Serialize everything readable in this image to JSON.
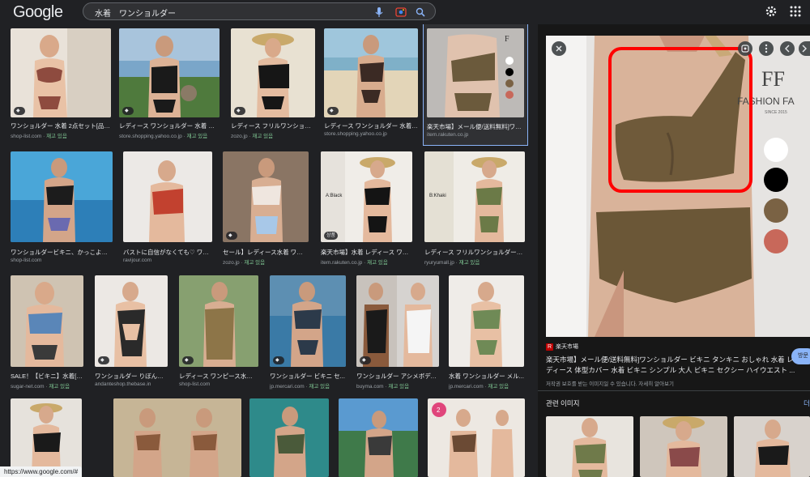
{
  "header": {
    "logo": "Google",
    "query": "水着　ワンショルダー"
  },
  "results": [
    {
      "title": "ワンショルダー 水着 2点セット[品番...",
      "source": "shop-list.com",
      "stock": "재고 있음",
      "badge": ""
    },
    {
      "title": "レディース ワンショルダー 水着 胸囲 ...",
      "source": "store.shopping.yahoo.co.jp",
      "stock": "재고 있음",
      "badge": ""
    },
    {
      "title": "レディース フリルワンショル...",
      "source": "zozo.jp",
      "stock": "재고 있음",
      "badge": ""
    },
    {
      "title": "レディース ワンショルダー 水着 ...",
      "source": "store.shopping.yahoo.co.jp",
      "stock": "",
      "badge": ""
    },
    {
      "title": "楽天市場】メール便/送料無料]ワン...",
      "source": "item.rakuten.co.jp",
      "stock": "",
      "badge": ""
    },
    {
      "title": "ワンショルダービキニ、かっこよく決...",
      "source": "shop-list.com",
      "stock": "",
      "badge": ""
    },
    {
      "title": "バストに自信がなくても♡ ワン...",
      "source": "ravijour.com",
      "stock": "",
      "badge": ""
    },
    {
      "title": "セール】レディース水着 ワンシ...",
      "source": "zozo.jp",
      "stock": "재고 있음",
      "badge": ""
    },
    {
      "title": "楽天市場】水着 レディース ワン...",
      "source": "item.rakuten.co.jp",
      "stock": "재고 있음",
      "badge": "상품"
    },
    {
      "title": "レディース フリルワンショルダービ...",
      "source": "ryuryumall.jp",
      "stock": "재고 있음",
      "badge": ""
    },
    {
      "title": "SALE！【ビキニ】水着[ワ...",
      "source": "sugar-net.com",
      "stock": "재고 있음",
      "badge": ""
    },
    {
      "title": "ワンショルダー りぼんバイ...",
      "source": "andanteshop.thebase.in",
      "stock": "",
      "badge": ""
    },
    {
      "title": "レディース ワンピース水着 ...",
      "source": "shop-list.com",
      "stock": "",
      "badge": ""
    },
    {
      "title": "ワンショルダー ビキニ セ...",
      "source": "jp.mercari.com",
      "stock": "재고 있음",
      "badge": ""
    },
    {
      "title": "ワンショルダー アシメボディ...",
      "source": "buyma.com",
      "stock": "재고 있음",
      "badge": ""
    },
    {
      "title": "水着 ワンショルダー メル...",
      "source": "jp.mercari.com",
      "stock": "재고 있음",
      "badge": ""
    }
  ],
  "panel": {
    "brand_line1": "FASHION FA",
    "brand_line2": "SINCE 2015",
    "source": "楽天市場",
    "title": "楽天市場】メール便/送料無料]ワンショルダー ビキニ タンキニ おしゃれ 水着 レディース 体型カバー 水着 ビキニ シンプル 大人 ビキニ セクシー ハイウエスト ...",
    "note": "저작권 보호를 받는 이미지일 수 있습니다. 자세히 알아보기",
    "visit_label": "방문",
    "related_label": "관련 이미지",
    "more_label": "더",
    "swatches": [
      "#ffffff",
      "#000000",
      "#7a6244",
      "#c8685a"
    ]
  },
  "status": {
    "url": "https://www.google.com/#"
  },
  "colors": {
    "background": "#202124",
    "panel": "#171717",
    "link": "#8ab4f8",
    "stock": "#81c995",
    "highlight": "#ff0000"
  }
}
